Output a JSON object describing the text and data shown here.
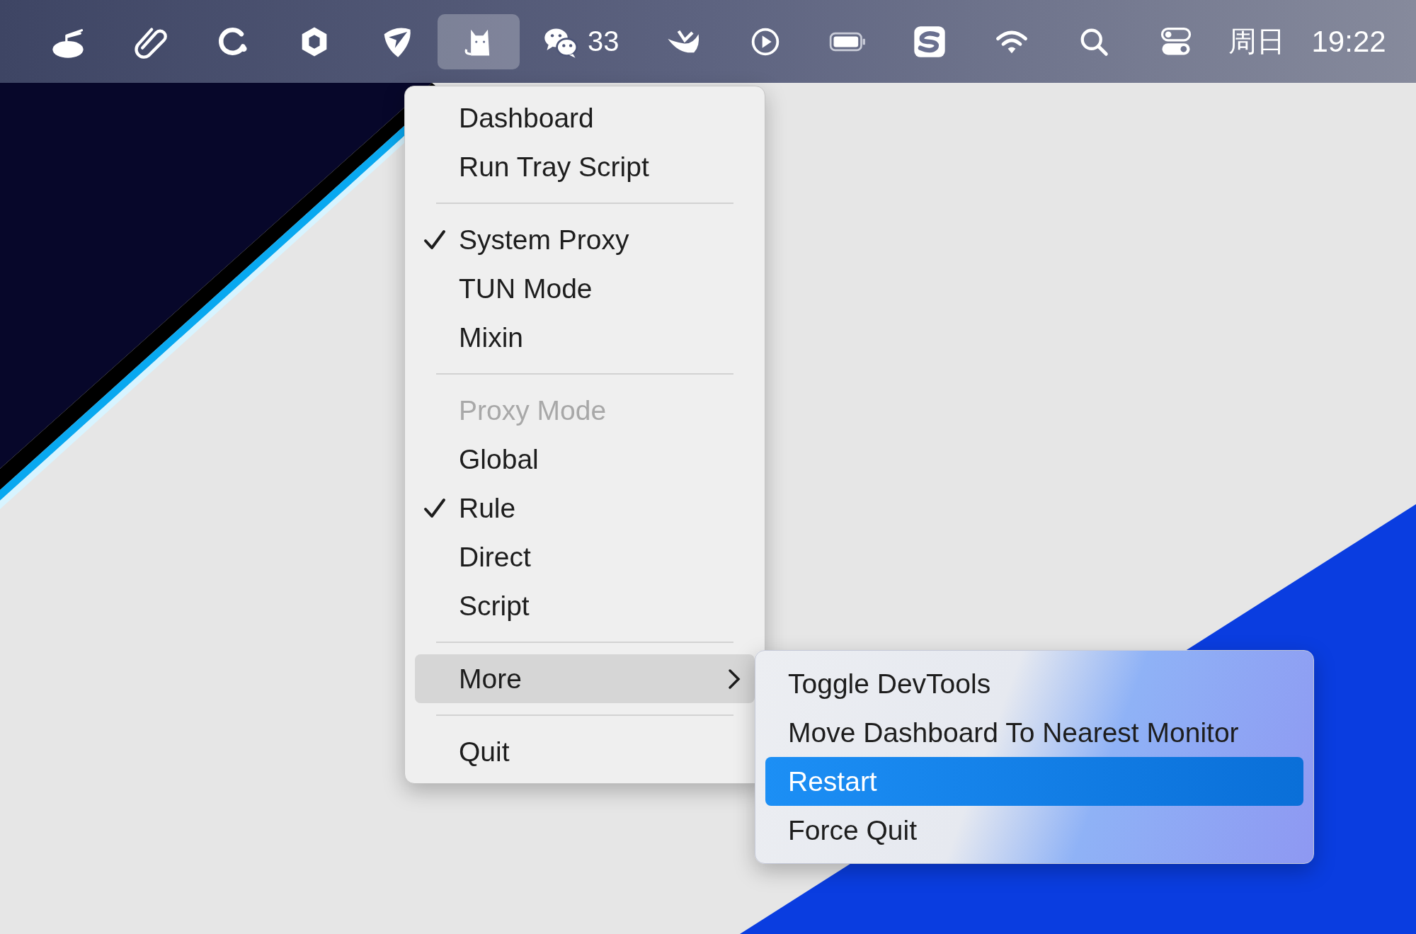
{
  "menu_bar": {
    "status_items": [
      {
        "selected": false
      },
      {
        "selected": false
      },
      {
        "selected": false
      },
      {
        "selected": false
      },
      {
        "selected": false
      },
      {
        "selected": true
      },
      {
        "selected": false,
        "badge": "33"
      },
      {
        "selected": false
      },
      {
        "selected": false
      },
      {
        "selected": false
      },
      {
        "selected": false
      },
      {
        "selected": false
      },
      {
        "selected": false
      },
      {
        "selected": false
      }
    ],
    "day": "周日",
    "time": "19:22"
  },
  "menu": {
    "items": [
      {
        "kind": "item",
        "label": "Dashboard",
        "checked": false,
        "disabled": false,
        "selected": false
      },
      {
        "kind": "item",
        "label": "Run Tray Script",
        "checked": false,
        "disabled": false,
        "selected": false
      },
      {
        "kind": "separator"
      },
      {
        "kind": "item",
        "label": "System Proxy",
        "checked": true,
        "disabled": false,
        "selected": false
      },
      {
        "kind": "item",
        "label": "TUN Mode",
        "checked": false,
        "disabled": false,
        "selected": false
      },
      {
        "kind": "item",
        "label": "Mixin",
        "checked": false,
        "disabled": false,
        "selected": false
      },
      {
        "kind": "separator"
      },
      {
        "kind": "item",
        "label": "Proxy Mode",
        "checked": false,
        "disabled": true,
        "selected": false
      },
      {
        "kind": "item",
        "label": "Global",
        "checked": false,
        "disabled": false,
        "selected": false
      },
      {
        "kind": "item",
        "label": "Rule",
        "checked": true,
        "disabled": false,
        "selected": false
      },
      {
        "kind": "item",
        "label": "Direct",
        "checked": false,
        "disabled": false,
        "selected": false
      },
      {
        "kind": "item",
        "label": "Script",
        "checked": false,
        "disabled": false,
        "selected": false
      },
      {
        "kind": "separator"
      },
      {
        "kind": "submenu",
        "label": "More",
        "checked": false,
        "disabled": false,
        "selected": true
      },
      {
        "kind": "separator"
      },
      {
        "kind": "item",
        "label": "Quit",
        "checked": false,
        "disabled": false,
        "selected": false
      }
    ]
  },
  "submenu": {
    "items": [
      {
        "label": "Toggle DevTools",
        "selected": false
      },
      {
        "label": "Move Dashboard To Nearest Monitor",
        "selected": false
      },
      {
        "label": "Restart",
        "selected": true
      },
      {
        "label": "Force Quit",
        "selected": false
      }
    ]
  }
}
